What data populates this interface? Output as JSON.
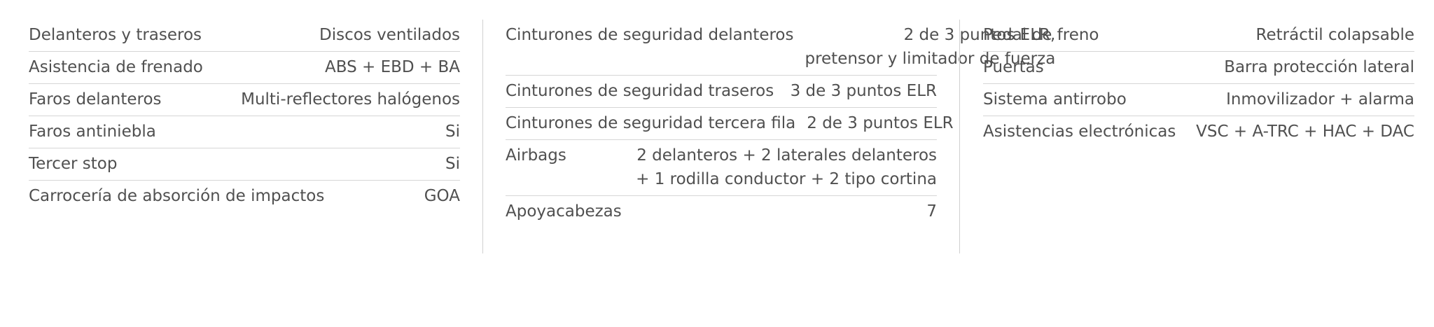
{
  "columns": [
    {
      "rows": [
        {
          "label": "Delanteros y traseros",
          "value": [
            "Discos ventilados"
          ]
        },
        {
          "label": "Asistencia de frenado",
          "value": [
            "ABS + EBD + BA"
          ]
        },
        {
          "label": "Faros delanteros",
          "value": [
            "Multi-reflectores halógenos"
          ]
        },
        {
          "label": "Faros antiniebla",
          "value": [
            "Si"
          ]
        },
        {
          "label": "Tercer stop",
          "value": [
            "Si"
          ]
        },
        {
          "label": "Carrocería de absorción de impactos",
          "value": [
            "GOA"
          ]
        }
      ]
    },
    {
      "rows": [
        {
          "label": "Cinturones de seguridad delanteros",
          "value": [
            "2 de 3 puntos ELR,",
            "pretensor y limitador de fuerza"
          ]
        },
        {
          "label": "Cinturones de seguridad traseros",
          "value": [
            "3 de 3 puntos ELR"
          ]
        },
        {
          "label": "Cinturones de seguridad tercera fila",
          "value": [
            "2 de 3 puntos ELR"
          ]
        },
        {
          "label": "Airbags",
          "value": [
            "2 delanteros + 2 laterales delanteros",
            "+ 1 rodilla conductor + 2 tipo cortina"
          ]
        },
        {
          "label": "Apoyacabezas",
          "value": [
            "7"
          ]
        }
      ]
    },
    {
      "rows": [
        {
          "label": "Pedal de freno",
          "value": [
            "Retráctil colapsable"
          ]
        },
        {
          "label": "Puertas",
          "value": [
            "Barra protección lateral"
          ]
        },
        {
          "label": "Sistema antirrobo",
          "value": [
            "Inmovilizador + alarma"
          ]
        },
        {
          "label": "Asistencias electrónicas",
          "value": [
            "VSC + A-TRC + HAC + DAC"
          ]
        }
      ]
    }
  ]
}
